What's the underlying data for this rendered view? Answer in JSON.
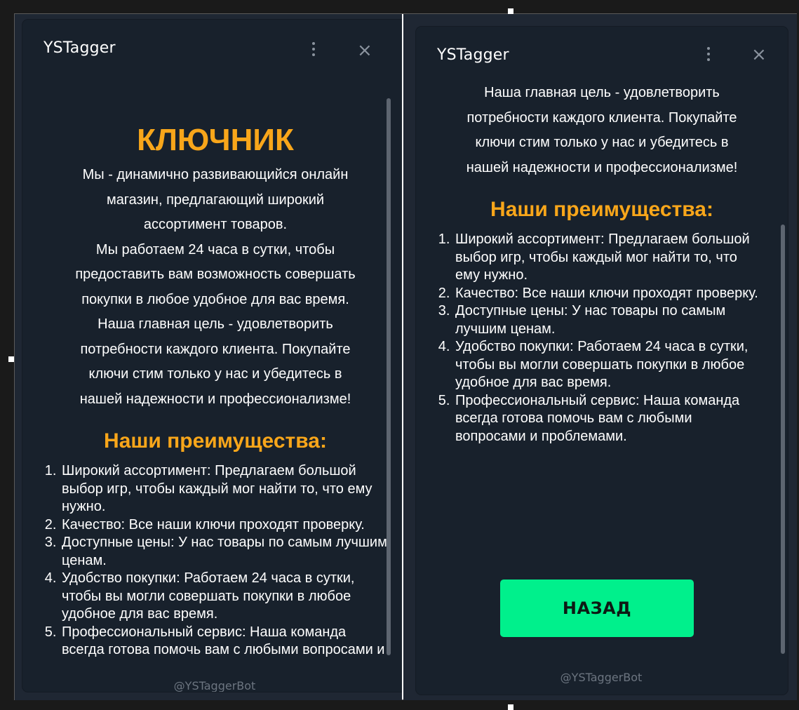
{
  "app": {
    "title": "YSTagger",
    "footer": "@YSTaggerBot"
  },
  "content": {
    "brand": "КЛЮЧНИК",
    "intro_lines": [
      "Мы - динамично развивающийся онлайн",
      "магазин, предлагающий широкий",
      "ассортимент товаров.",
      "Мы работаем 24 часа в сутки, чтобы",
      "предоставить вам возможность совершать",
      "покупки в любое удобное для вас время.",
      "Наша главная цель - удовлетворить",
      "потребности каждого клиента. Покупайте",
      "ключи стим только у нас и убедитесь в",
      "нашей надежности и профессионализме!"
    ],
    "advantages_title": "Наши преимущества:",
    "advantages": [
      "Широкий ассортимент: Предлагаем большой выбор игр, чтобы каждый мог найти то, что ему нужно.",
      "Качество: Все наши ключи проходят проверку.",
      "Доступные цены: У нас товары по самым лучшим ценам.",
      "Удобство покупки: Работаем 24 часа в сутки, чтобы вы могли совершать покупки в любое удобное для вас время.",
      "Профессиональный сервис: Наша команда всегда готова помочь вам с любыми вопросами и проблемами."
    ],
    "back_label": "НАЗАД"
  },
  "colors": {
    "accent": "#f8a61a",
    "button": "#00f08c",
    "card_bg": "#18212c"
  },
  "icons": {
    "menu": "kebab-menu-icon",
    "close": "close-icon"
  }
}
